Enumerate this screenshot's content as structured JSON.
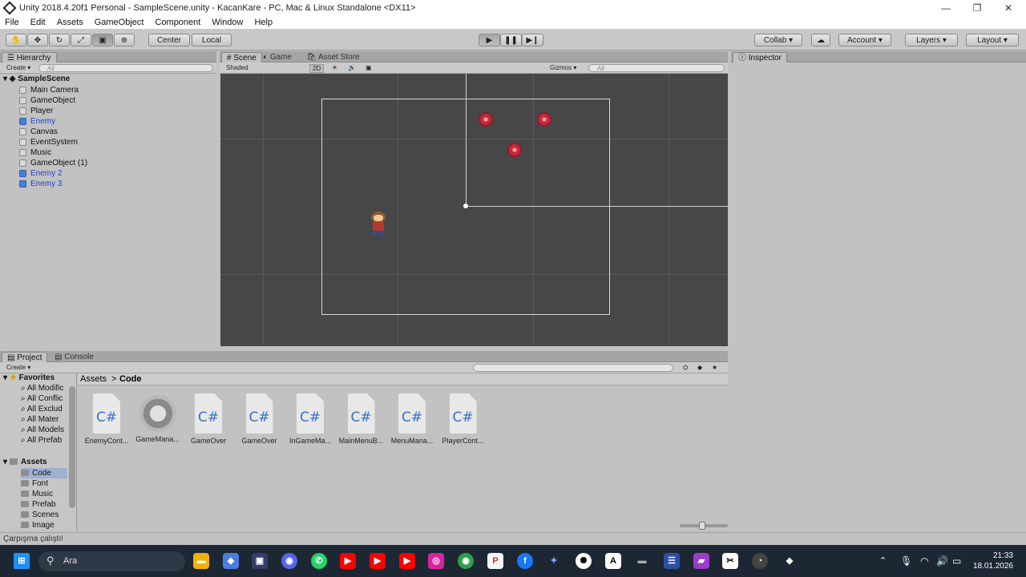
{
  "window": {
    "title": "Unity 2018.4.20f1 Personal - SampleScene.unity - KacanKare - PC, Mac & Linux Standalone <DX11>",
    "min": "—",
    "max": "❐",
    "close": "✕"
  },
  "menu": [
    "File",
    "Edit",
    "Assets",
    "GameObject",
    "Component",
    "Window",
    "Help"
  ],
  "toolbar": {
    "center": "Center",
    "local": "Local",
    "play": "▶",
    "pause": "❚❚",
    "step": "▶❙",
    "collab": "Collab ▾",
    "account": "Account",
    "layers": "Layers",
    "layout": "Layout"
  },
  "hierarchy": {
    "tab": "Hierarchy",
    "create": "Create ▾",
    "search_placeholder": "All",
    "scene": "SampleScene",
    "items": [
      {
        "label": "Main Camera",
        "blue": false
      },
      {
        "label": "GameObject",
        "blue": false
      },
      {
        "label": "Player",
        "blue": false
      },
      {
        "label": "Enemy",
        "blue": true
      },
      {
        "label": "Canvas",
        "blue": false
      },
      {
        "label": "EventSystem",
        "blue": false
      },
      {
        "label": "Music",
        "blue": false
      },
      {
        "label": "GameObject (1)",
        "blue": false
      },
      {
        "label": "Enemy 2",
        "blue": true
      },
      {
        "label": "Enemy 3",
        "blue": true
      }
    ]
  },
  "scene_view": {
    "tabs": [
      "Scene",
      "Game",
      "Asset Store"
    ],
    "shading": "Shaded",
    "mode2d": "2D",
    "gizmos": "Gizmos ▾",
    "search_placeholder": "All"
  },
  "inspector": {
    "tab": "Inspector"
  },
  "project": {
    "tabs": [
      "Project",
      "Console"
    ],
    "create": "Create ▾",
    "breadcrumb": [
      "Assets",
      "Code"
    ],
    "favorites_label": "Favorites",
    "favorites": [
      "All Modific",
      "All Conflic",
      "All Exclud",
      "All Mater",
      "All Models",
      "All Prefab"
    ],
    "assets_label": "Assets",
    "folders": [
      "Code",
      "Font",
      "Music",
      "Prefab",
      "Scenes",
      "Image"
    ],
    "files": [
      {
        "name": "EnemyCont...",
        "type": "cs"
      },
      {
        "name": "GameMana...",
        "type": "gear"
      },
      {
        "name": "GameOver",
        "type": "cs"
      },
      {
        "name": "GameOver",
        "type": "cs"
      },
      {
        "name": "InGameMa...",
        "type": "cs"
      },
      {
        "name": "MainMenuB...",
        "type": "cs"
      },
      {
        "name": "MenuMana...",
        "type": "cs"
      },
      {
        "name": "PlayerCont...",
        "type": "cs"
      }
    ],
    "cs_glyph": "C#"
  },
  "status": {
    "message": "Çarpışma çalıştı!"
  },
  "taskbar": {
    "search": "Ara",
    "time": "21:33",
    "date": "18.01.2026"
  }
}
